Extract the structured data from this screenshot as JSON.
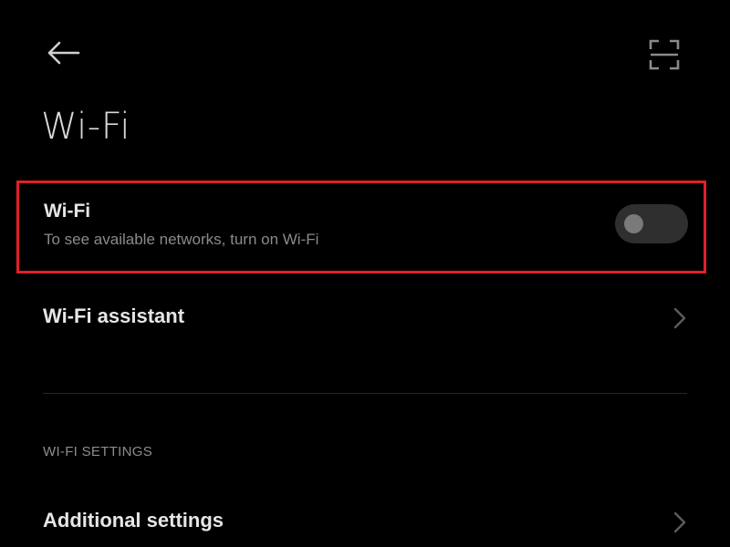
{
  "header": {
    "title": "Wi-Fi",
    "back_icon": "arrow-left-icon",
    "scan_icon": "scan-qr-icon"
  },
  "wifi_toggle_row": {
    "label": "Wi-Fi",
    "description": "To see available networks, turn on Wi-Fi",
    "enabled": false,
    "highlight_color": "#e01f2a"
  },
  "wifi_assistant": {
    "label": "Wi-Fi assistant",
    "icon": "chevron-right-icon"
  },
  "wifi_settings": {
    "section_title": "WI-FI SETTINGS",
    "items": [
      {
        "label": "Additional settings",
        "icon": "chevron-right-icon"
      }
    ]
  },
  "colors": {
    "background": "#000000",
    "text_primary": "#e6e6e6",
    "text_secondary": "#8a8a8a",
    "toggle_track_off": "#2f2f2f",
    "toggle_knob_off": "#7a7a7a"
  }
}
